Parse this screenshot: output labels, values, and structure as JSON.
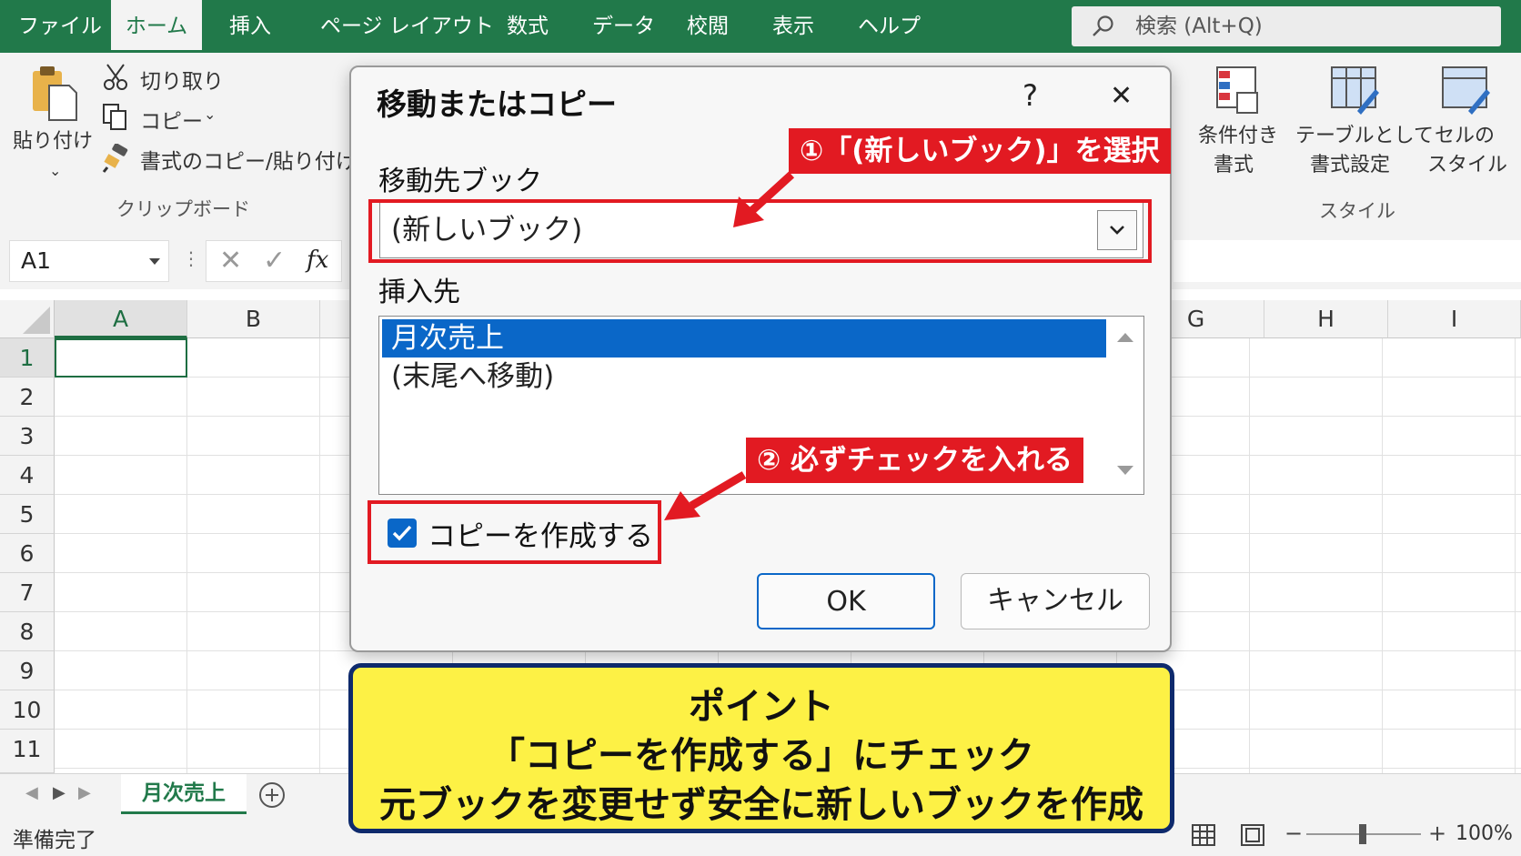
{
  "tabs": [
    "ファイル",
    "ホーム",
    "挿入",
    "ページ レイアウト",
    "数式",
    "データ",
    "校閲",
    "表示",
    "ヘルプ"
  ],
  "active_tab": "ホーム",
  "search": {
    "placeholder": "検索 (Alt+Q)"
  },
  "ribbon": {
    "paste_label": "貼り付け",
    "cut_label": "切り取り",
    "copy_label": "コピー",
    "format_painter_label": "書式のコピー/貼り付け",
    "clipboard_group": "クリップボード",
    "conditional_format": [
      "条件付き",
      "書式"
    ],
    "format_as_table": [
      "テーブルとして",
      "書式設定"
    ],
    "cell_styles": [
      "セルの",
      "スタイル"
    ],
    "styles_group": "スタイル"
  },
  "formula_bar": {
    "name_box": "A1",
    "fx": "fx"
  },
  "columns_left": [
    "A",
    "B"
  ],
  "columns_right": [
    "G",
    "H",
    "I"
  ],
  "rows": [
    "1",
    "2",
    "3",
    "4",
    "5",
    "6",
    "7",
    "8",
    "9",
    "10",
    "11"
  ],
  "sheet_tab": "月次売上",
  "status": {
    "ready": "準備完了",
    "zoom": "100%"
  },
  "dialog": {
    "title": "移動またはコピー",
    "help": "?",
    "close": "✕",
    "to_book_label": "移動先ブック",
    "to_book_value": "(新しいブック)",
    "before_sheet_label": "挿入先",
    "sheets": [
      "月次売上",
      "(末尾へ移動)"
    ],
    "selected_sheet_index": 0,
    "create_copy_label": "コピーを作成する",
    "create_copy_checked": true,
    "ok_label": "OK",
    "cancel_label": "キャンセル"
  },
  "annotations": {
    "step1": "①「(新しいブック)」を選択",
    "step2": "② 必ずチェックを入れる"
  },
  "point_box": {
    "title": "ポイント",
    "line1": "「コピーを作成する」にチェック",
    "line2": "元ブックを変更せず安全に新しいブックを作成"
  },
  "colors": {
    "excel_green": "#21794a",
    "highlight_red": "#e21a22",
    "selection_blue": "#0a67c8",
    "point_yellow": "#fdf145",
    "point_border": "#0e2a6c"
  }
}
